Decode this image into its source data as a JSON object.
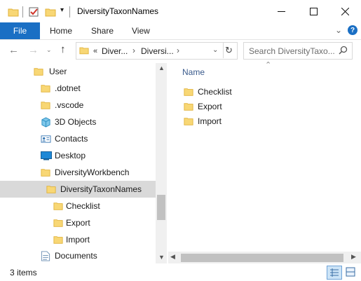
{
  "window": {
    "title": "DiversityTaxonNames"
  },
  "ribbon": {
    "tabs": [
      "File",
      "Home",
      "Share",
      "View"
    ]
  },
  "address": {
    "overflow": "«",
    "segments": [
      "Diver...",
      "Diversi..."
    ],
    "search_placeholder": "Search DiversityTaxo..."
  },
  "tree": {
    "items": [
      {
        "label": "User",
        "indent": 1
      },
      {
        "label": ".dotnet",
        "indent": 2
      },
      {
        "label": ".vscode",
        "indent": 2
      },
      {
        "label": "3D Objects",
        "indent": 2
      },
      {
        "label": "Contacts",
        "indent": 2
      },
      {
        "label": "Desktop",
        "indent": 2
      },
      {
        "label": "DiversityWorkbench",
        "indent": 2
      },
      {
        "label": "DiversityTaxonNames",
        "indent": 3,
        "selected": true
      },
      {
        "label": "Checklist",
        "indent": 4
      },
      {
        "label": "Export",
        "indent": 4
      },
      {
        "label": "Import",
        "indent": 4
      },
      {
        "label": "Documents",
        "indent": 2
      }
    ]
  },
  "content": {
    "column_name": "Name",
    "files": [
      "Checklist",
      "Export",
      "Import"
    ]
  },
  "status": {
    "item_count": "3 items"
  },
  "colors": {
    "accent": "#1a6fc4",
    "folder": "#f8d775",
    "selected": "#d9d9d9"
  }
}
